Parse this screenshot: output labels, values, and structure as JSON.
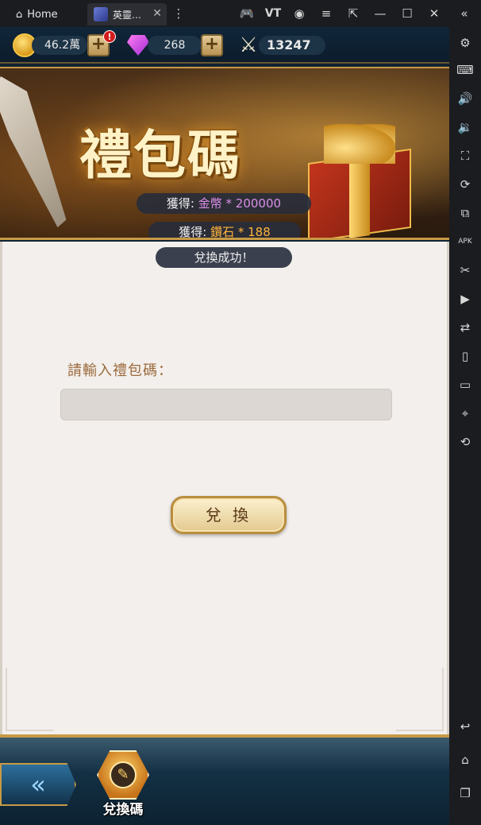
{
  "emulator": {
    "tab_home_label": "Home",
    "tab_game_label": "英靈…",
    "tab_close": "✕",
    "window_controls": {
      "minimize": "—",
      "maximize": "☐",
      "close": "✕",
      "collapse": "«"
    },
    "toolbar_icons": [
      "gamepad-icon",
      "vt-icon",
      "account-icon",
      "menu-icon",
      "expand-icon"
    ],
    "sidebar_icons": [
      "settings-icon",
      "keyboard-icon",
      "volume-up-icon",
      "volume-down-icon",
      "screenshot-area-icon",
      "rotate-icon",
      "multi-instance-icon",
      "apk-icon",
      "scissors-icon",
      "record-icon",
      "sync-icon",
      "shake-icon",
      "folder-icon",
      "location-icon",
      "rotate-screen-icon",
      "back-arrow-icon",
      "home-icon",
      "recent-apps-icon"
    ]
  },
  "resources": {
    "gold": "46.2萬",
    "gems": "268",
    "power": "13247",
    "alert": "!"
  },
  "banner": {
    "title": "禮包碼",
    "reward_gold_prefix": "獲得: ",
    "reward_gold_value": "金幣 * 200000",
    "reward_gem_prefix": "獲得: ",
    "reward_gem_value": "鑽石 * 188",
    "success_message": "兌換成功！"
  },
  "form": {
    "prompt": "請輸入禮包碼：",
    "input_value": "",
    "redeem_button": "兌 換"
  },
  "bottom_nav": {
    "back_label": "«",
    "redeem_tab_label": "兌換碼"
  },
  "colors": {
    "gold_reward": "#d98ee8",
    "gem_reward": "#ffb43a",
    "panel_bg": "#f3efec",
    "accent_gold": "#c79a45"
  }
}
